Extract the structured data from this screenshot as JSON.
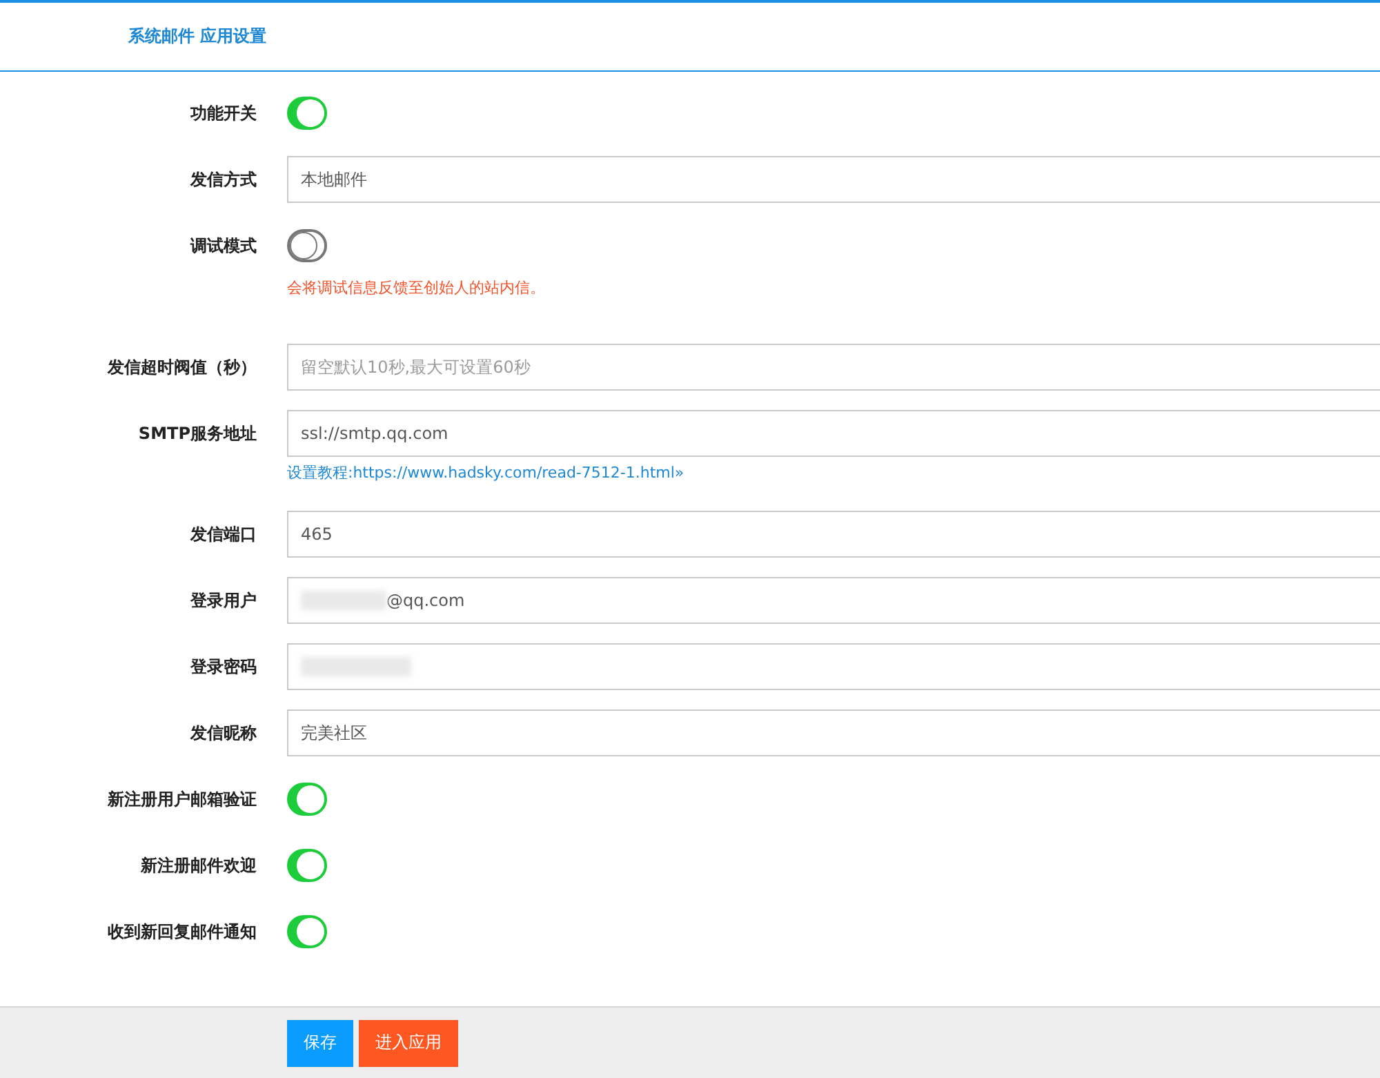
{
  "header": {
    "title": "系统邮件 应用设置"
  },
  "rows": [
    {
      "label": "功能开关",
      "kind": "toggle",
      "on": true
    },
    {
      "label": "发信方式",
      "kind": "select",
      "value": "本地邮件"
    },
    {
      "label": "调试模式",
      "kind": "toggle",
      "on": false,
      "note": {
        "kind": "warning",
        "text": "会将调试信息反馈至创始人的站内信。"
      }
    },
    {
      "label": "发信超时阀值（秒）",
      "kind": "input",
      "placeholder": "留空默认10秒,最大可设置60秒"
    },
    {
      "label": "SMTP服务地址",
      "kind": "input",
      "value": "ssl://smtp.qq.com",
      "note": {
        "kind": "link",
        "text": "设置教程:https://www.hadsky.com/read-7512-1.html»"
      }
    },
    {
      "label": "发信端口",
      "kind": "input",
      "value": "465"
    },
    {
      "label": "登录用户",
      "kind": "input",
      "value": "@qq.com",
      "blurred": true
    },
    {
      "label": "登录密码",
      "kind": "input",
      "blurred": true
    },
    {
      "label": "发信昵称",
      "kind": "input",
      "value": "完美社区"
    },
    {
      "label": "新注册用户邮箱验证",
      "kind": "toggle",
      "on": true
    },
    {
      "label": "新注册邮件欢迎",
      "kind": "toggle",
      "on": true
    },
    {
      "label": "收到新回复邮件通知",
      "kind": "toggle",
      "on": true
    }
  ],
  "buttons": [
    {
      "label": "保存",
      "kind": "primary"
    },
    {
      "label": "进入应用",
      "kind": "secondary"
    }
  ]
}
